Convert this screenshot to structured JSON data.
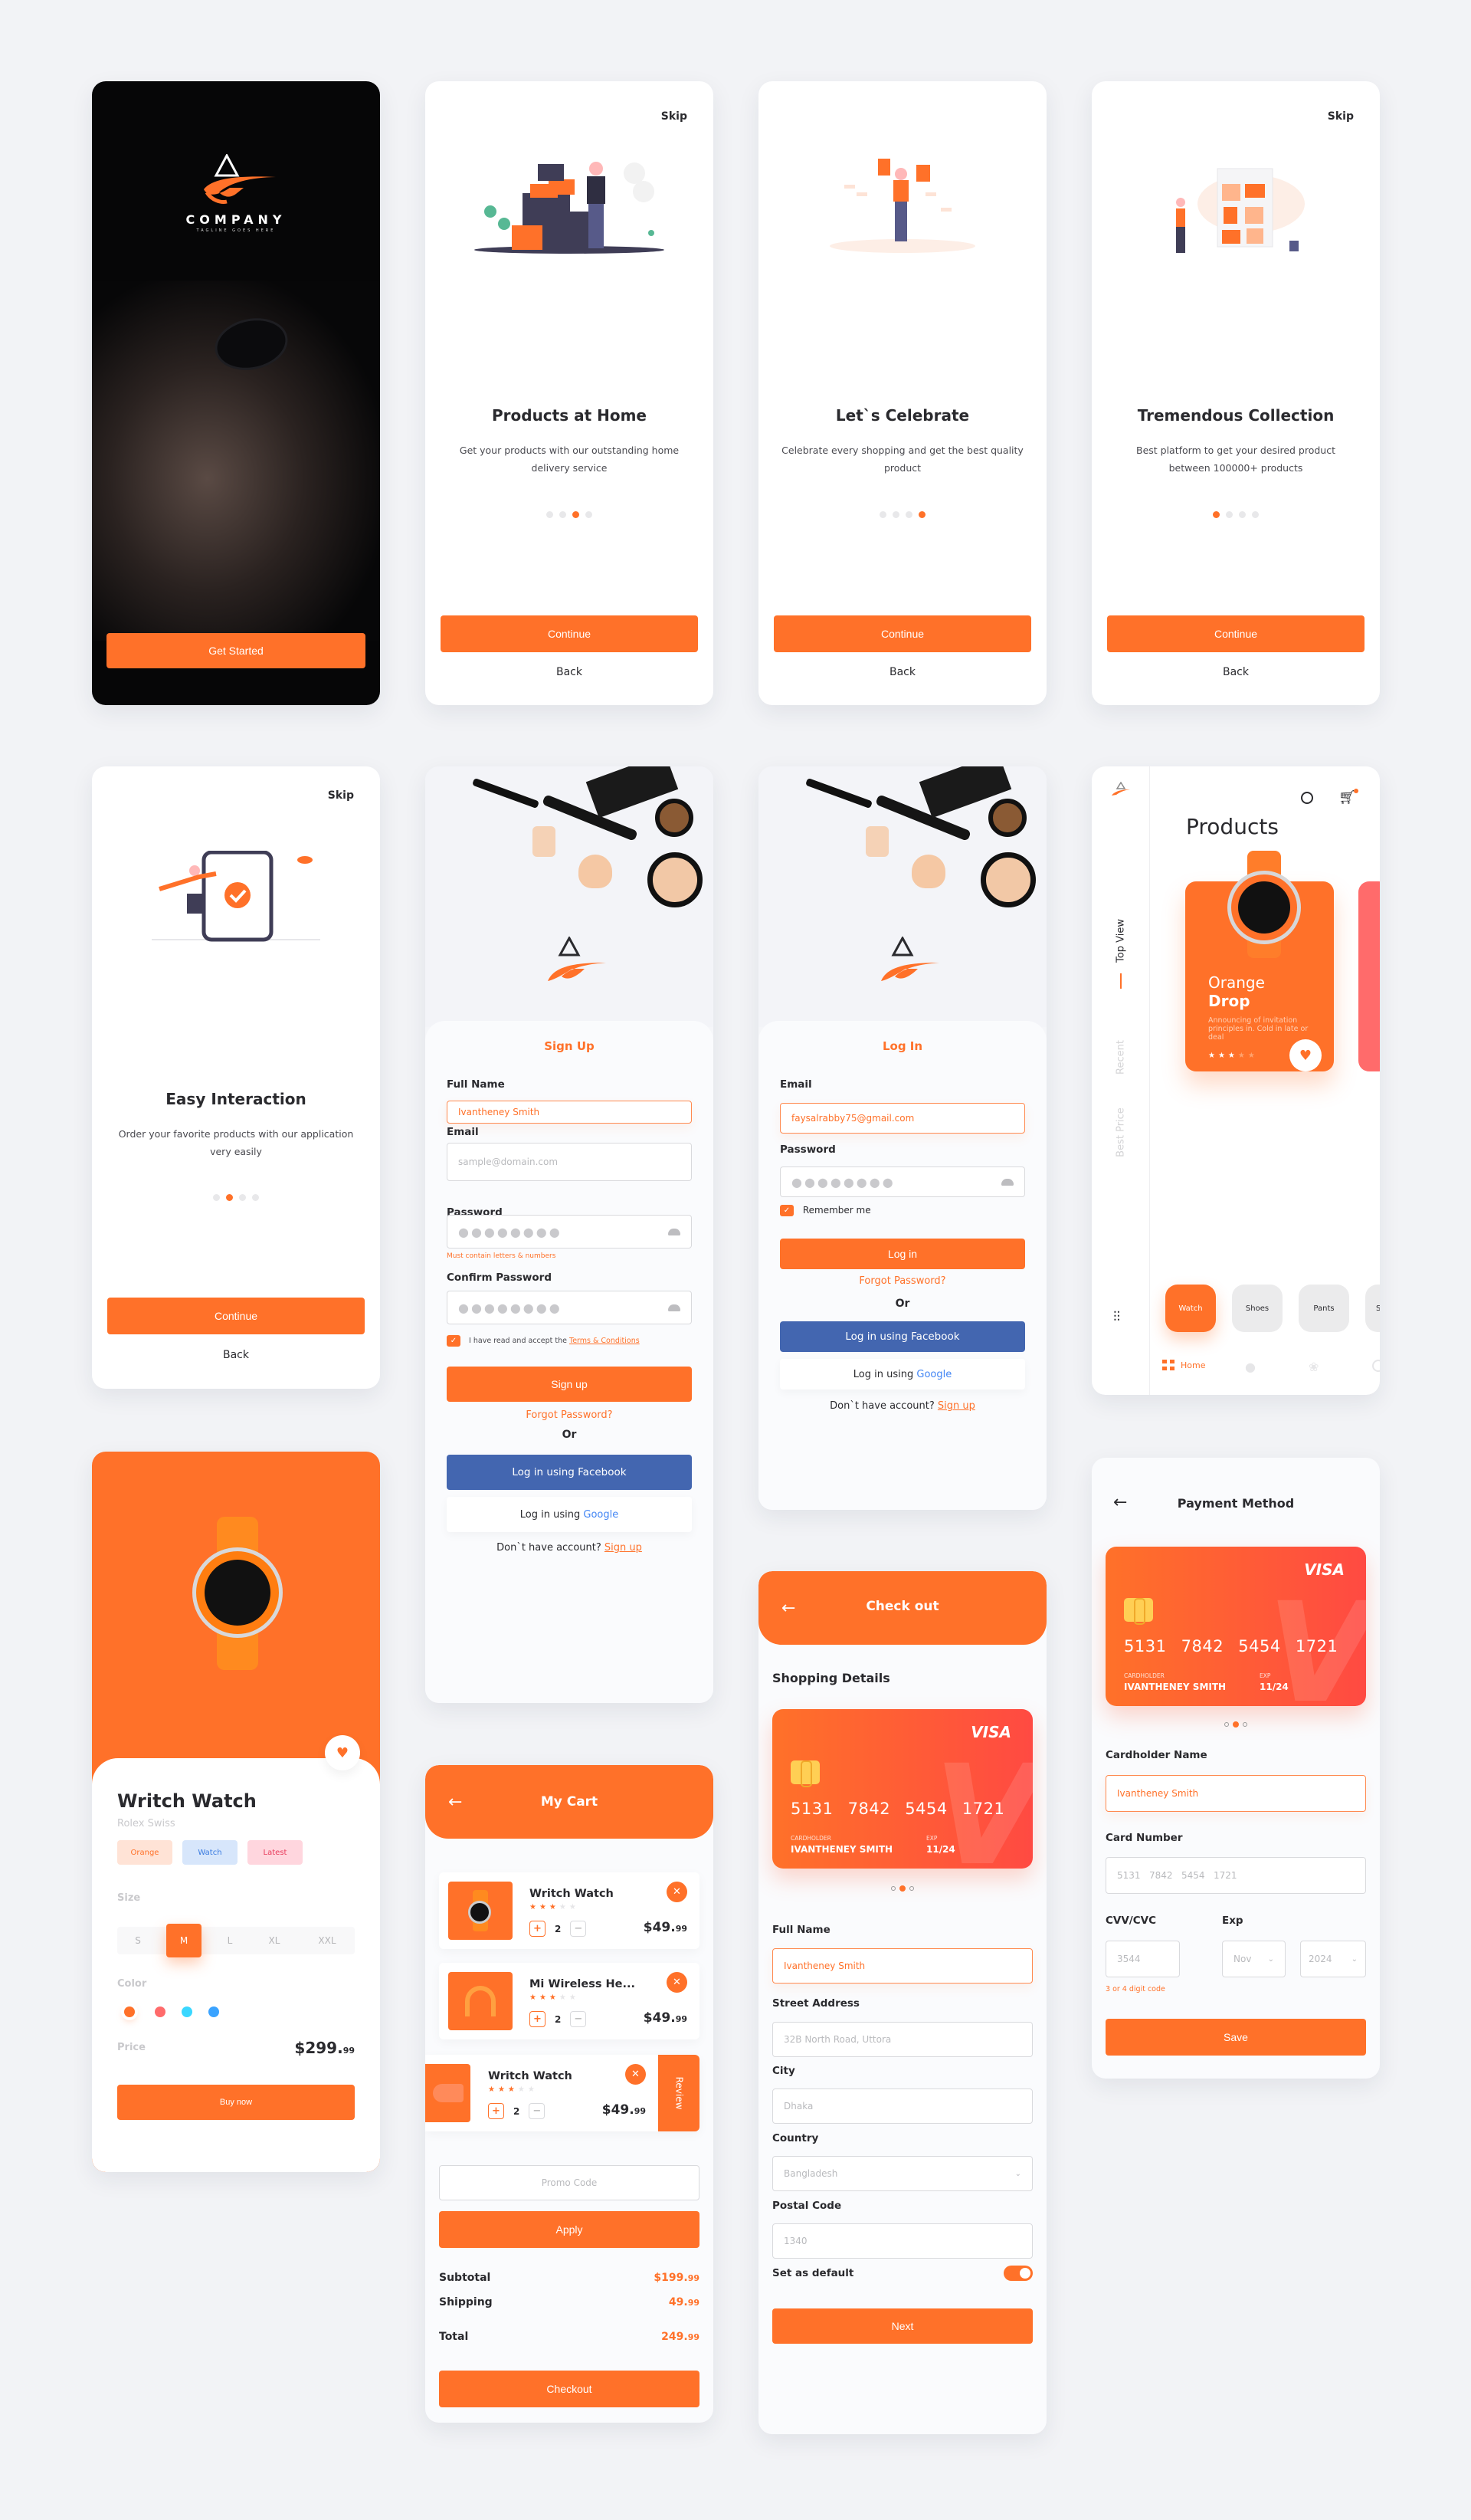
{
  "brand": {
    "accent": "#ff7129",
    "facebook": "#4366b0",
    "company_name": "COMPANY",
    "tagline": "TAGLINE GOES HERE"
  },
  "splash": {
    "button": "Get Started"
  },
  "onboarding": [
    {
      "skip": "Skip",
      "title": "Products at Home",
      "desc": "Get your products with our outstanding home delivery service",
      "dots": 4,
      "active_dot": 3,
      "continue": "Continue",
      "back": "Back"
    },
    {
      "skip": "",
      "title": "Let`s Celebrate",
      "desc": "Celebrate every shopping and get the best quality product",
      "dots": 4,
      "active_dot": 4,
      "continue": "Continue",
      "back": "Back"
    },
    {
      "skip": "Skip",
      "title": "Tremendous Collection",
      "desc": "Best platform to get your desired product between 100000+ products",
      "dots": 4,
      "active_dot": 1,
      "continue": "Continue",
      "back": "Back"
    },
    {
      "skip": "Skip",
      "title": "Easy Interaction",
      "desc": "Order your favorite products with our application very easily",
      "dots": 4,
      "active_dot": 2,
      "continue": "Continue",
      "back": "Back"
    }
  ],
  "signup": {
    "title": "Sign Up",
    "full_name_label": "Full Name",
    "full_name_value": "Ivantheney Smith",
    "email_label": "Email",
    "email_placeholder": "sample@domain.com",
    "password_label": "Password",
    "password_mask": "●●●●●●●●",
    "password_hint": "Must contain letters & numbers",
    "confirm_label": "Confirm Password",
    "confirm_mask": "●●●●●●●●",
    "terms_prefix": "I have read and accept the ",
    "terms_link": "Terms & Conditions",
    "terms_checked": true,
    "submit": "Sign up",
    "forgot": "Forgot Password?",
    "or": "Or",
    "facebook": "Log in using Facebook",
    "google_prefix": "Log in using ",
    "google_word": "Google",
    "no_account": "Don`t have account? ",
    "no_account_link": "Sign up"
  },
  "login": {
    "title": "Log In",
    "email_label": "Email",
    "email_value": "faysalrabby75@gmail.com",
    "password_label": "Password",
    "password_mask": "●●●●●●●●",
    "remember": "Remember me",
    "remember_checked": true,
    "submit": "Log in",
    "forgot": "Forgot Password?",
    "or": "Or",
    "facebook": "Log in using Facebook",
    "google_prefix": "Log in using ",
    "google_word": "Google",
    "no_account": "Don`t have account? ",
    "no_account_link": "Sign up"
  },
  "products": {
    "title": "Products",
    "side_tabs": [
      "Top View",
      "Recent",
      "Best Price"
    ],
    "active_side_tab": "Top View",
    "card": {
      "title_light": "Orange",
      "title_bold": "Drop",
      "desc": "Announcing of invitation principles in. Cold in late or deal",
      "rating": 3,
      "rating_max": 5
    },
    "categories": [
      "Watch",
      "Shoes",
      "Pants",
      "S"
    ],
    "active_category": "Watch",
    "nav": [
      {
        "icon": "grid-icon",
        "label": "Home",
        "active": true
      },
      {
        "icon": "user-icon",
        "label": ""
      },
      {
        "icon": "gift-icon",
        "label": ""
      },
      {
        "icon": "logout-icon",
        "label": ""
      }
    ]
  },
  "product_detail": {
    "name": "Writch Watch",
    "brand": "Rolex Swiss",
    "tags": [
      {
        "label": "Orange",
        "bg": "#ffe3d6",
        "fg": "#ff7129"
      },
      {
        "label": "Watch",
        "bg": "#d7e6fb",
        "fg": "#3a7be0"
      },
      {
        "label": "Latest",
        "bg": "#ffd6de",
        "fg": "#e83a5a"
      }
    ],
    "size_label": "Size",
    "sizes": [
      "S",
      "M",
      "L",
      "XL",
      "XXL"
    ],
    "selected_size": "M",
    "color_label": "Color",
    "colors": [
      "#ff7129",
      "#ff6b6b",
      "#3ad7ff",
      "#3aa3ff"
    ],
    "selected_color": "#ff7129",
    "price_label": "Price",
    "price_main": "$299.",
    "price_cents": "99",
    "buy": "Buy now"
  },
  "cart": {
    "title": "My Cart",
    "items": [
      {
        "name": "Writch Watch",
        "rating": 3,
        "qty": "2",
        "price_main": "$49.",
        "price_cents": "99",
        "thumb": "watch"
      },
      {
        "name": "Mi Wireless He...",
        "rating": 3,
        "qty": "2",
        "price_main": "$49.",
        "price_cents": "99",
        "thumb": "headphones"
      },
      {
        "name": "Writch Watch",
        "rating": 3,
        "qty": "2",
        "price_main": "$49.",
        "price_cents": "99",
        "thumb": "shoe",
        "swiped": true
      }
    ],
    "review_action": "Review",
    "promo_placeholder": "Promo Code",
    "apply": "Apply",
    "subtotal_label": "Subtotal",
    "subtotal_main": "$199.",
    "subtotal_cents": "99",
    "shipping_label": "Shipping",
    "shipping_main": "49.",
    "shipping_cents": "99",
    "total_label": "Total",
    "total_main": "249.",
    "total_cents": "99",
    "checkout": "Checkout"
  },
  "card": {
    "brand": "VISA",
    "number": "5131 7842 5454 1721",
    "holder_label": "CARDHOLDER",
    "holder": "IVANTHENEY SMITH",
    "exp_label": "EXP",
    "exp": "11/24",
    "slides": 3,
    "active_slide": 2
  },
  "checkout": {
    "title": "Check out",
    "section": "Shopping Details",
    "full_name_label": "Full Name",
    "full_name_value": "Ivantheney Smith",
    "street_label": "Street Address",
    "street_placeholder": "32B North Road, Uttora",
    "city_label": "City",
    "city_placeholder": "Dhaka",
    "country_label": "Country",
    "country_value": "Bangladesh",
    "postal_label": "Postal Code",
    "postal_placeholder": "1340",
    "default_label": "Set as default",
    "default_on": true,
    "next": "Next"
  },
  "payment": {
    "title": "Payment Method",
    "holder_label": "Cardholder Name",
    "holder_value": "Ivantheney Smith",
    "number_label": "Card Number",
    "number_placeholder": "5131   7842   5454   1721",
    "cvv_label": "CVV/CVC",
    "cvv_placeholder": "3544",
    "cvv_hint": "3 or 4 digit code",
    "exp_label": "Exp",
    "exp_month": "Nov",
    "exp_year": "2024",
    "save": "Save"
  }
}
